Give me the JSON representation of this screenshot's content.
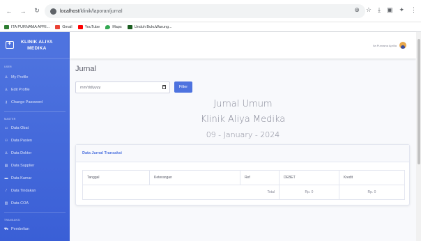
{
  "browser": {
    "url_host": "localhost",
    "url_path": "/klinik/laporan/jurnal",
    "bookmarks": [
      "ITA PURNAMA APRI...",
      "Gmail",
      "YouTube",
      "Maps",
      "Unduh BukuWarung..."
    ]
  },
  "sidebar": {
    "brand_line1": "KLINIK ALIYA",
    "brand_line2": "MEDIKA",
    "section_user": "USER",
    "section_master": "MASTER",
    "section_transaksi": "TRANSAKSI",
    "items": [
      {
        "label": "My Profile",
        "icon": "user-icon"
      },
      {
        "label": "Edit Profile",
        "icon": "user-edit-icon"
      },
      {
        "label": "Change Password",
        "icon": "key-icon"
      },
      {
        "label": "Data Obat",
        "icon": "pills-icon"
      },
      {
        "label": "Data Pasien",
        "icon": "users-icon"
      },
      {
        "label": "Data Dokter",
        "icon": "doctor-icon"
      },
      {
        "label": "Data Supplier",
        "icon": "truck-icon"
      },
      {
        "label": "Data Kamar",
        "icon": "bed-icon"
      },
      {
        "label": "Data Tindakan",
        "icon": "syringe-icon"
      },
      {
        "label": "Data COA",
        "icon": "book-icon"
      },
      {
        "label": "Pembelian",
        "icon": "cart-icon"
      }
    ]
  },
  "topbar": {
    "user_name": "Ita Purnama Aprilia"
  },
  "content": {
    "page_title": "Jurnal",
    "date_placeholder": "mm/dd/yyyy",
    "filter_label": "Filter",
    "report_title": "Jurnal Umum",
    "report_clinic": "Klinik Aliya Medika",
    "report_date": "09 - January - 2024",
    "card_title": "Data Jurnal Transaksi",
    "table": {
      "headers": [
        "Tanggal",
        "Keterangan",
        "Ref",
        "DEBET",
        "Kredit"
      ],
      "total_label": "Total",
      "total_debet": "Rp. 0",
      "total_kredit": "Rp. 0"
    }
  },
  "colors": {
    "primary": "#4e73df",
    "sidebar_dark": "#3a5fd6"
  }
}
